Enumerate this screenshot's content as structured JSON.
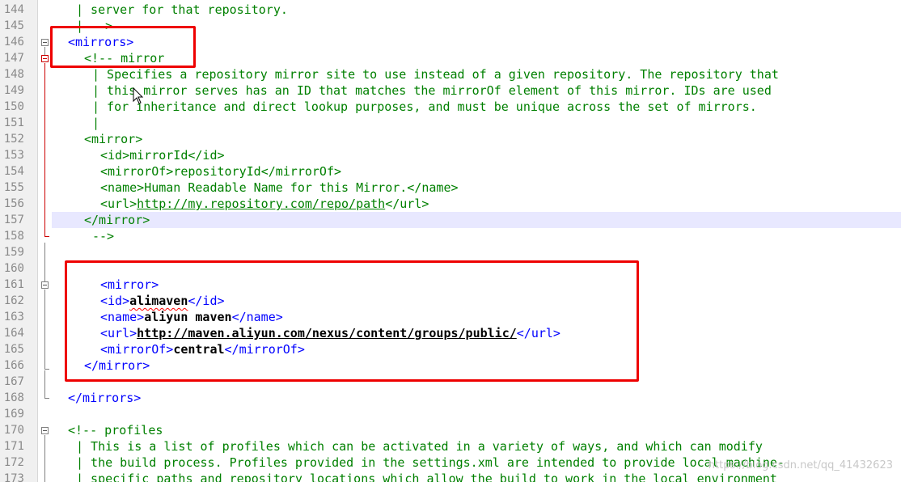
{
  "editor": {
    "highlight_color": "#ee0000",
    "current_line": "157",
    "cursor_icon": "i-beam-cursor-icon",
    "watermark": "https://blog.csdn.net/qq_41432623",
    "lines": {
      "144": "| server for that repository.",
      "145": "| -->",
      "146": "<mirrors>",
      "147": "<!-- mirror",
      "148": "| Specifies a repository mirror site to use instead of a given repository. The repository that",
      "149": "| this mirror serves has an ID that matches the mirrorOf element of this mirror. IDs are used",
      "150": "| for inheritance and direct lookup purposes, and must be unique across the set of mirrors.",
      "151": "|",
      "152": "<mirror>",
      "153_open": "<id>",
      "153_val": "mirrorId",
      "153_close": "</id>",
      "154_open": "<mirrorOf>",
      "154_val": "repositoryId",
      "154_close": "</mirrorOf>",
      "155_open": "<name>",
      "155_val": "Human Readable Name for this Mirror.",
      "155_close": "</name>",
      "156_open": "<url>",
      "156_val": "http://my.repository.com/repo/path",
      "156_close": "</url>",
      "157": "</mirror>",
      "158": "-->",
      "161": "<mirror>",
      "162_open": "<id>",
      "162_val": "alimaven",
      "162_close": "</id>",
      "163_open": "<name>",
      "163_val": "aliyun maven",
      "163_close": "</name>",
      "164_open": "<url>",
      "164_val": "http://maven.aliyun.com/nexus/content/groups/public/",
      "164_close": "</url>",
      "165_open": "<mirrorOf>",
      "165_val": "central",
      "165_close": "</mirrorOf>",
      "166": "</mirror>",
      "168": "</mirrors>",
      "170": "<!-- profiles",
      "171": "| This is a list of profiles which can be activated in a variety of ways, and which can modify",
      "172": "| the build process. Profiles provided in the settings.xml are intended to provide local machine-",
      "173": "| specific paths and repository locations which allow the build to work in the local environment"
    },
    "line_numbers": [
      "144",
      "145",
      "146",
      "147",
      "148",
      "149",
      "150",
      "151",
      "152",
      "153",
      "154",
      "155",
      "156",
      "157",
      "158",
      "159",
      "160",
      "161",
      "162",
      "163",
      "164",
      "165",
      "166",
      "167",
      "168",
      "169",
      "170",
      "171",
      "172",
      "173"
    ]
  }
}
